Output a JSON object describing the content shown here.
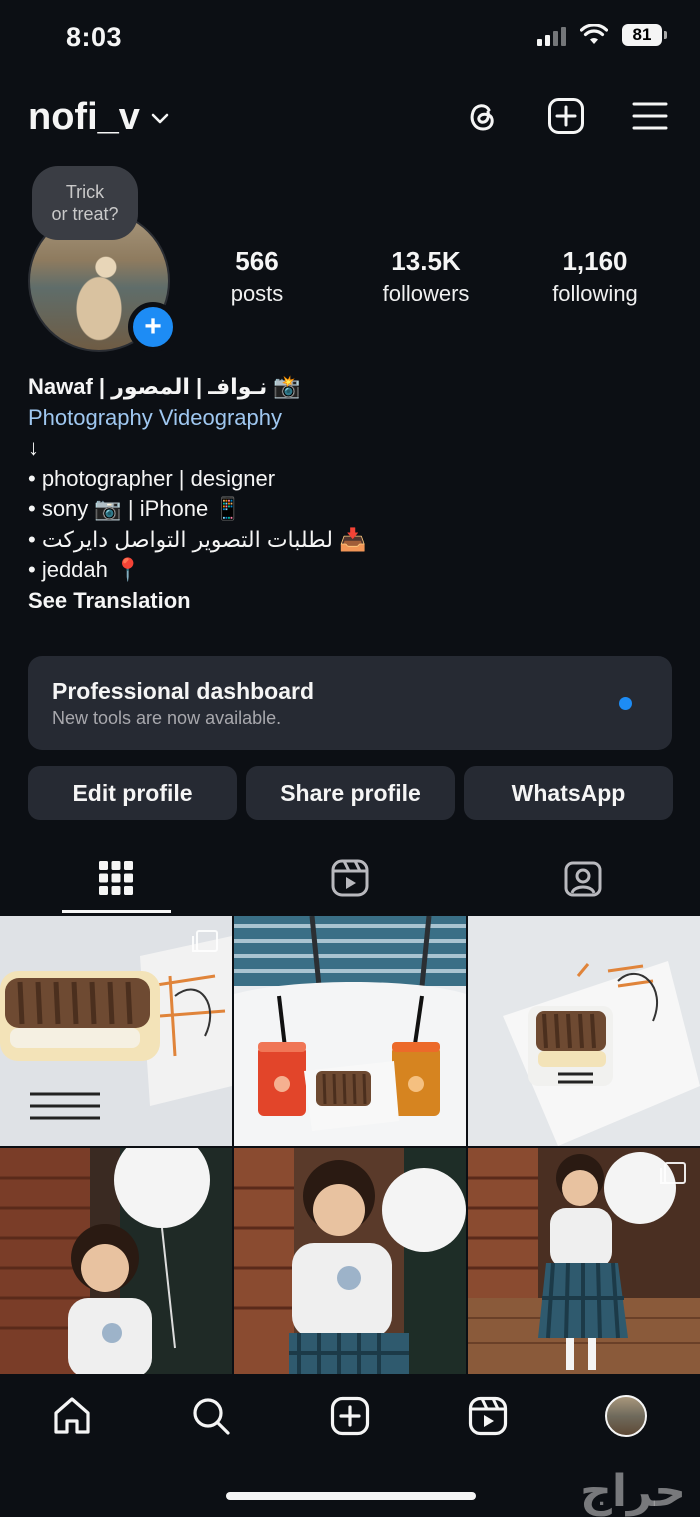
{
  "status": {
    "time": "8:03",
    "battery": "81"
  },
  "header": {
    "username": "nofi_v"
  },
  "note": {
    "line1": "Trick",
    "line2": "or treat?"
  },
  "stats": [
    {
      "value": "566",
      "label": "posts"
    },
    {
      "value": "13.5K",
      "label": "followers"
    },
    {
      "value": "1,160",
      "label": "following"
    }
  ],
  "bio": {
    "name": "Nawaf | نـوافـ | المصور 📸",
    "category": "Photography Videography",
    "arrow": "↓",
    "lines": [
      "• photographer | designer",
      "• sony 📷 | iPhone  📱",
      "• لطلبات التصوير التواصل دايركت 📥",
      "• jeddah 📍"
    ],
    "see_translation": "See Translation"
  },
  "dashboard": {
    "title": "Professional dashboard",
    "subtitle": "New tools are now available."
  },
  "buttons": {
    "edit": "Edit profile",
    "share": "Share profile",
    "whatsapp": "WhatsApp"
  },
  "watermark": "حراج",
  "colors": {
    "background": "#0c0f14",
    "card": "#262a33",
    "accent": "#1d8cf5",
    "link": "#9fc7f0"
  }
}
